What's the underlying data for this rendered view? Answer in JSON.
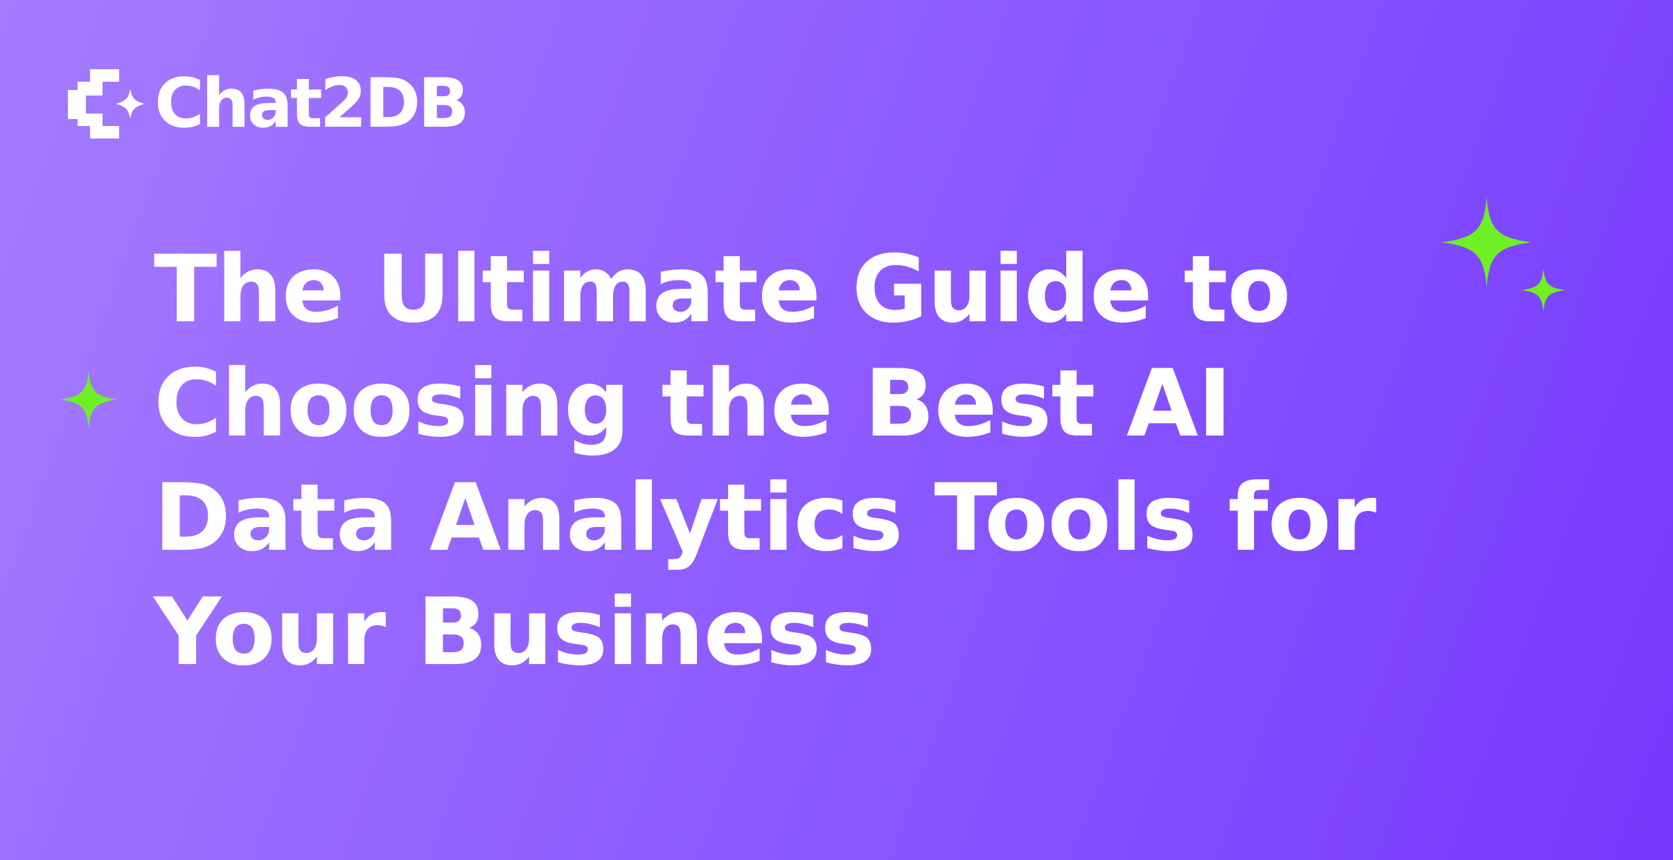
{
  "brand": {
    "name": "Chat2DB",
    "logo_icon": "chat2db-logo-icon"
  },
  "headline": "The Ultimate Guide to Choosing the Best AI Data Analytics Tools for Your Business",
  "decorations": {
    "sparkle_icon": "four-point-star-icon",
    "sparkle_color": "#6ef025"
  },
  "colors": {
    "background_start": "#a57cff",
    "background_end": "#7638fb",
    "text": "#ffffff"
  }
}
